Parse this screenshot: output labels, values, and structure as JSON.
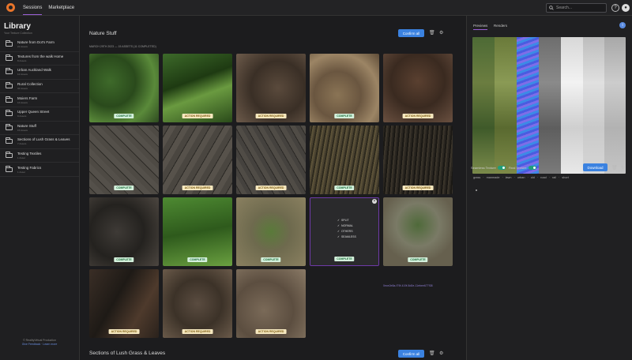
{
  "topbar": {
    "tabs": [
      "Sessions",
      "Marketplace"
    ],
    "search_placeholder": "Search...",
    "help_icon": "?",
    "user_icon": "●"
  },
  "sidebar": {
    "title": "Library",
    "subtitle": "Your Texture Collection",
    "items": [
      {
        "name": "Nature from Dot's Farm",
        "count": "21 Assets"
      },
      {
        "name": "Textures from the walk Home",
        "count": "8 Assets"
      },
      {
        "name": "Urban Auckland Walk",
        "count": "12 Assets"
      },
      {
        "name": "Rural Collection",
        "count": "34 Assets"
      },
      {
        "name": "Moiers Farm",
        "count": "16 Assets"
      },
      {
        "name": "Upper Queen Street",
        "count": "9 Assets"
      },
      {
        "name": "Nature Stuff",
        "count": "15 Assets"
      },
      {
        "name": "Sections of Lush Grass & Leaves",
        "count": "7 Assets"
      },
      {
        "name": "Testing Textiles",
        "count": "1 Asset"
      },
      {
        "name": "Testing Fabrics",
        "count": "1 Asset"
      }
    ],
    "footer_line": "© RealityVirtual Production",
    "footer_links": "Give Feedback · Learn more"
  },
  "main": {
    "section1": {
      "title": "Nature Stuff",
      "meta": "MARCH 29TH 2023 — 15 ASSETS (11 COMPLETED)",
      "button": "Confirm all"
    },
    "section2": {
      "title": "Sections of Lush Grass & Leaves",
      "button": "Confirm all"
    },
    "tiles": [
      {
        "status": "COMPLETE",
        "kind": "ok"
      },
      {
        "status": "ACTION REQUIRED",
        "kind": "warn"
      },
      {
        "status": "ACTION REQUIRED",
        "kind": "warn"
      },
      {
        "status": "COMPLETE",
        "kind": "ok"
      },
      {
        "status": "ACTION REQUIRED",
        "kind": "warn"
      },
      {
        "status": "COMPLETE",
        "kind": "ok"
      },
      {
        "status": "ACTION REQUIRED",
        "kind": "warn"
      },
      {
        "status": "ACTION REQUIRED",
        "kind": "warn"
      },
      {
        "status": "COMPLETE",
        "kind": "ok"
      },
      {
        "status": "ACTION REQUIRED",
        "kind": "warn"
      },
      {
        "status": "COMPLETE",
        "kind": "ok"
      },
      {
        "status": "COMPLETE",
        "kind": "ok"
      },
      {
        "status": "COMPLETE",
        "kind": "ok"
      },
      {
        "status": "COMPLETE",
        "kind": "ok"
      },
      {
        "status": "COMPLETE",
        "kind": "ok"
      },
      {
        "status": "ACTION REQUIRED",
        "kind": "warn"
      },
      {
        "status": "ACTION REQUIRED",
        "kind": "warn"
      },
      {
        "status": "ACTION REQUIRED",
        "kind": "warn"
      }
    ],
    "special_checks": [
      "SPLIT",
      "NORMAL",
      "OTHERS",
      "SEAMLESS"
    ],
    "selected_link": "0ece2e8a-f79f-419f-8d0e-11ebee677f38"
  },
  "right": {
    "tabs": [
      "Previews",
      "Renders"
    ],
    "info_icon": "i",
    "seamless_label": "Seamless Texture",
    "final_label": "Final Texture",
    "download": "Download",
    "tags": [
      "grass",
      "manmade",
      "lawn",
      "urban",
      "old",
      "road",
      "rail",
      "short"
    ]
  }
}
